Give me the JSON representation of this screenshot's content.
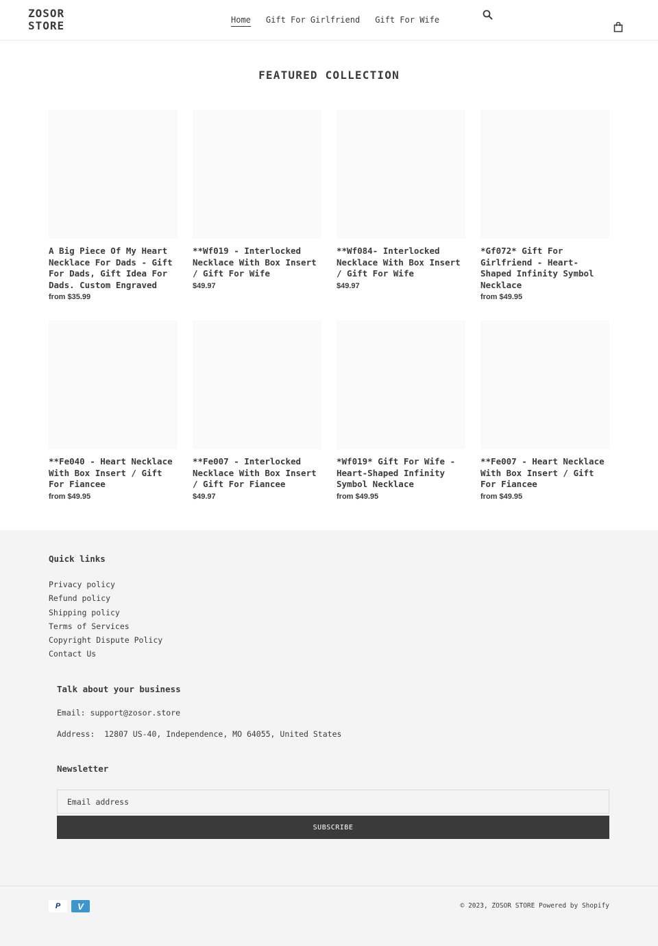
{
  "header": {
    "logo": "ZOSOR STORE",
    "nav": [
      {
        "label": "Home",
        "active": true
      },
      {
        "label": "Gift For Girlfriend",
        "active": false
      },
      {
        "label": "Gift For Wife",
        "active": false
      }
    ],
    "search_icon": "search-icon",
    "cart_icon": "shopping-bag-icon"
  },
  "featured": {
    "title": "FEATURED COLLECTION",
    "products": [
      {
        "title": "A Big Piece Of My Heart Necklace For Dads - Gift For Dads, Gift Idea For Dads. Custom Engraved",
        "price": "from $35.99"
      },
      {
        "title": "**Wf019 - Interlocked Necklace With Box Insert / Gift For Wife",
        "price": "$49.97"
      },
      {
        "title": "**Wf084- Interlocked Necklace With Box Insert / Gift For Wife",
        "price": "$49.97"
      },
      {
        "title": "*Gf072* Gift For Girlfriend - Heart-Shaped Infinity Symbol Necklace",
        "price": "from $49.95"
      },
      {
        "title": "**Fe040 - Heart Necklace With Box Insert / Gift For Fiancee",
        "price": "from $49.95"
      },
      {
        "title": "**Fe007 - Interlocked Necklace With Box Insert / Gift For Fiancee",
        "price": "$49.97"
      },
      {
        "title": "*Wf019* Gift For Wife - Heart-Shaped Infinity Symbol Necklace",
        "price": "from $49.95"
      },
      {
        "title": "**Fe007 - Heart Necklace With Box Insert / Gift For Fiancee",
        "price": "from $49.95"
      }
    ]
  },
  "footer": {
    "quick_links": {
      "heading": "Quick links",
      "items": [
        "Privacy policy",
        "Refund policy",
        "Shipping policy",
        "Terms of Services",
        "Copyright Dispute Policy",
        "Contact Us"
      ]
    },
    "business": {
      "heading": "Talk about your business",
      "email": "Email: support@zosor.store",
      "address": "Address:  12807 US-40, Independence, MO 64055, United States"
    },
    "newsletter": {
      "heading": "Newsletter",
      "placeholder": "Email address",
      "value": "",
      "button": "SUBSCRIBE"
    },
    "payments": [
      {
        "name": "PayPal",
        "glyph": "P",
        "color": "#003087"
      },
      {
        "name": "Venmo",
        "glyph": "V",
        "color": "#3d95ce"
      }
    ],
    "copyright": "© 2023, ZOSOR STORE",
    "powered_by": "Powered by Shopify"
  },
  "colors": {
    "text": "#3a3a3a",
    "button_bg": "#3a3a3a",
    "footer_bg": "#f4f4f4",
    "image_placeholder": "#fafafa"
  }
}
